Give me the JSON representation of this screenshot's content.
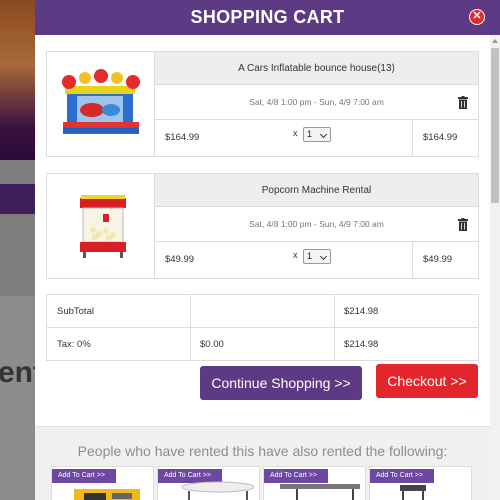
{
  "modal": {
    "title": "SHOPPING CART",
    "close_symbol": "✕"
  },
  "background": {
    "text_fragment": "ent"
  },
  "cart": {
    "items": [
      {
        "name": "A Cars Inflatable bounce house(13)",
        "dates": "Sat, 4/8 1:00 pm - Sun, 4/9 7:00 am",
        "price": "$164.99",
        "qty_prefix": "x",
        "qty": "1",
        "total": "$164.99",
        "image_icon": "bounce-house-image"
      },
      {
        "name": "Popcorn Machine Rental",
        "dates": "Sat, 4/8 1:00 pm - Sun, 4/9 7:00 am",
        "price": "$49.99",
        "qty_prefix": "x",
        "qty": "1",
        "total": "$49.99",
        "image_icon": "popcorn-machine-image"
      }
    ],
    "subtotal_label": "SubTotal",
    "subtotal_value": "$214.98",
    "tax_label": "Tax: 0%",
    "tax_value": "$0.00",
    "grand_total": "$214.98"
  },
  "buttons": {
    "continue": "Continue Shopping >>",
    "checkout": "Checkout >>"
  },
  "related": {
    "heading": "People who have rented this have also rented the following:",
    "add_to_cart_label": "Add To Cart >>",
    "cards": [
      "generator-image",
      "table-image",
      "table-image",
      "chair-image"
    ]
  },
  "colors": {
    "purple": "#5d3a84",
    "red": "#e3262b"
  }
}
